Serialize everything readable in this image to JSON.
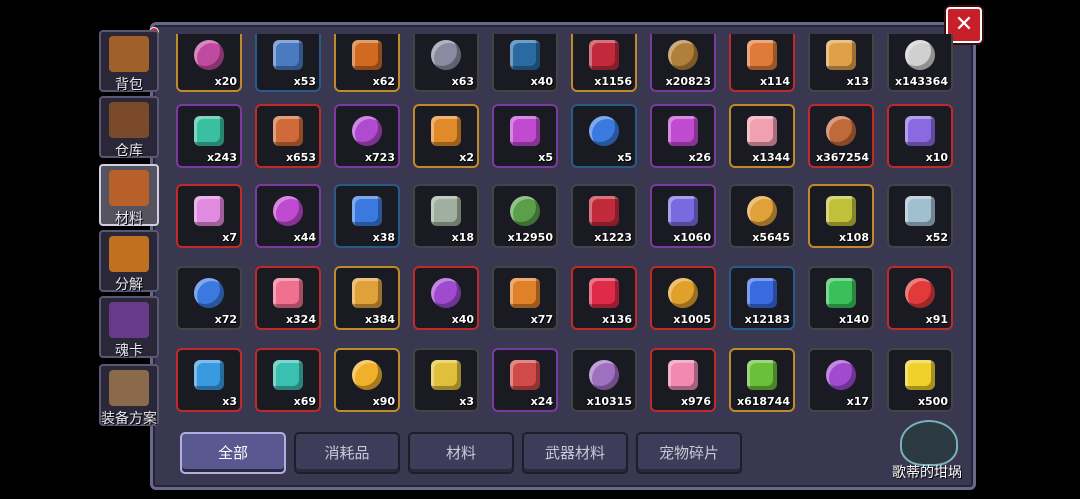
{
  "sidebar": {
    "items": [
      {
        "label": "背包",
        "icon": "chest-icon",
        "color": "#a0602a"
      },
      {
        "label": "仓库",
        "icon": "warehouse-icon",
        "color": "#7a4a2a"
      },
      {
        "label": "材料",
        "icon": "materials-book-icon",
        "color": "#b8602a"
      },
      {
        "label": "分解",
        "icon": "pot-icon",
        "color": "#c07020"
      },
      {
        "label": "魂卡",
        "icon": "soul-card-icon",
        "color": "#6a3a8a"
      },
      {
        "label": "装备方案",
        "icon": "crossed-swords-icon",
        "color": "#8a6a4a"
      }
    ],
    "active_index": 2
  },
  "close_label": "✕",
  "filters": [
    "全部",
    "消耗品",
    "材料",
    "武器材料",
    "宠物碎片"
  ],
  "active_filter": 0,
  "cauldron_label": "歌蒂的坩埚",
  "items": [
    {
      "count": "x20",
      "border": "#c08a2a",
      "icon": "purple-box-icon",
      "color": "#c04aa0"
    },
    {
      "count": "x53",
      "border": "#2a5a8a",
      "icon": "blue-box-icon",
      "color": "#4a7ac0"
    },
    {
      "count": "x62",
      "border": "#c08a2a",
      "icon": "gold-chest-icon",
      "color": "#d06a20"
    },
    {
      "count": "x63",
      "border": "#444",
      "icon": "gray-robot-icon",
      "color": "#8a8aa0"
    },
    {
      "count": "x40",
      "border": "#444",
      "icon": "star-jar-icon",
      "color": "#2a6aa0"
    },
    {
      "count": "x1156",
      "border": "#c08a2a",
      "icon": "red-crystal-icon",
      "color": "#c02a3a"
    },
    {
      "count": "x20823",
      "border": "#7a3aa0",
      "icon": "bronze-rune-icon",
      "color": "#b0803a"
    },
    {
      "count": "x114",
      "border": "#c02a2a",
      "icon": "ore-pile-icon",
      "color": "#e07a3a"
    },
    {
      "count": "x13",
      "border": "#444",
      "icon": "sand-pile-icon",
      "color": "#e0a04a"
    },
    {
      "count": "x143364",
      "border": "#444",
      "icon": "silver-pile-icon",
      "color": "#d0d0d0"
    },
    {
      "count": "x243",
      "border": "#7a3aa0",
      "icon": "green-gem-icon",
      "color": "#3ac0a0"
    },
    {
      "count": "x653",
      "border": "#c02a2a",
      "icon": "orange-gem-icon",
      "color": "#d06a3a"
    },
    {
      "count": "x723",
      "border": "#7a3aa0",
      "icon": "purple-gem-icon",
      "color": "#b04ad0"
    },
    {
      "count": "x2",
      "border": "#c08a2a",
      "icon": "orange-key-gem-icon",
      "color": "#e08a2a"
    },
    {
      "count": "x5",
      "border": "#7a3aa0",
      "icon": "purple-key-gem-icon",
      "color": "#c04ad0"
    },
    {
      "count": "x5",
      "border": "#2a5a8a",
      "icon": "blue-key-gem-icon",
      "color": "#3a7ae0"
    },
    {
      "count": "x26",
      "border": "#7a3aa0",
      "icon": "battery-icon",
      "color": "#c04ad0"
    },
    {
      "count": "x1344",
      "border": "#c08a2a",
      "icon": "pink-bone-icon",
      "color": "#f0a0b0"
    },
    {
      "count": "x367254",
      "border": "#c02a2a",
      "icon": "leather-icon",
      "color": "#c06a3a"
    },
    {
      "count": "x10",
      "border": "#c02a2a",
      "icon": "rainbow-crystal-icon",
      "color": "#8a6ae0"
    },
    {
      "count": "x7",
      "border": "#c02a2a",
      "icon": "pink-crystal-icon",
      "color": "#e08ae0"
    },
    {
      "count": "x44",
      "border": "#7a3aa0",
      "icon": "small-purple-shard-icon",
      "color": "#c04ad0"
    },
    {
      "count": "x38",
      "border": "#2a5a8a",
      "icon": "small-blue-shard-icon",
      "color": "#3a7ae0"
    },
    {
      "count": "x18",
      "border": "#444",
      "icon": "small-gray-shard-icon",
      "color": "#a0b0a0"
    },
    {
      "count": "x12950",
      "border": "#444",
      "icon": "green-emblem-icon",
      "color": "#5aa04a"
    },
    {
      "count": "x1223",
      "border": "#444",
      "icon": "red-shield-icon",
      "color": "#c02a3a"
    },
    {
      "count": "x1060",
      "border": "#7a3aa0",
      "icon": "crystal-cluster-icon",
      "color": "#7a6ae0"
    },
    {
      "count": "x5645",
      "border": "#444",
      "icon": "star-pile-icon",
      "color": "#e0a03a"
    },
    {
      "count": "x108",
      "border": "#c08a2a",
      "icon": "yellow-green-gem-icon",
      "color": "#c0c03a"
    },
    {
      "count": "x52",
      "border": "#444",
      "icon": "ice-crystal-icon",
      "color": "#a0c0d0"
    },
    {
      "count": "x72",
      "border": "#444",
      "icon": "blue-ring-icon",
      "color": "#3a7ae0"
    },
    {
      "count": "x324",
      "border": "#c02a2a",
      "icon": "pink-petal-icon",
      "color": "#f07090"
    },
    {
      "count": "x384",
      "border": "#c08a2a",
      "icon": "medal-icon",
      "color": "#e0a03a"
    },
    {
      "count": "x40",
      "border": "#c02a2a",
      "icon": "purple-flame-icon",
      "color": "#a04ad0"
    },
    {
      "count": "x77",
      "border": "#444",
      "icon": "explosion-icon",
      "color": "#e0802a"
    },
    {
      "count": "x136",
      "border": "#c02a2a",
      "icon": "ruby-cluster-icon",
      "color": "#e02a4a"
    },
    {
      "count": "x1005",
      "border": "#c02a2a",
      "icon": "gold-shards-icon",
      "color": "#e0a02a"
    },
    {
      "count": "x12183",
      "border": "#2a5a8a",
      "icon": "blue-shard-icon",
      "color": "#3a6ae0"
    },
    {
      "count": "x140",
      "border": "#444",
      "icon": "emerald-icon",
      "color": "#3ac05a"
    },
    {
      "count": "x91",
      "border": "#c02a2a",
      "icon": "ruby-icon",
      "color": "#e03a3a"
    },
    {
      "count": "x3",
      "border": "#c02a2a",
      "icon": "sapphire-icon",
      "color": "#3a9ae0"
    },
    {
      "count": "x69",
      "border": "#c02a2a",
      "icon": "prism-gem-icon",
      "color": "#3ac0b0"
    },
    {
      "count": "x90",
      "border": "#c08a2a",
      "icon": "topaz-icon",
      "color": "#f0b02a"
    },
    {
      "count": "x3",
      "border": "#444",
      "icon": "gold-cross-icon",
      "color": "#e0c03a"
    },
    {
      "count": "x24",
      "border": "#7a3aa0",
      "icon": "hourglass-icon",
      "color": "#d04a4a"
    },
    {
      "count": "x10315",
      "border": "#444",
      "icon": "purple-slime-icon",
      "color": "#a070c0"
    },
    {
      "count": "x976",
      "border": "#c02a2a",
      "icon": "pink-monster-icon",
      "color": "#f08ab0"
    },
    {
      "count": "x618744",
      "border": "#c08a2a",
      "icon": "green-slime-icon",
      "color": "#6ac03a"
    },
    {
      "count": "x17",
      "border": "#444",
      "icon": "purple-owl-icon",
      "color": "#a04ad0"
    },
    {
      "count": "x500",
      "border": "#444",
      "icon": "yellow-smiley-icon",
      "color": "#f0d02a"
    }
  ]
}
